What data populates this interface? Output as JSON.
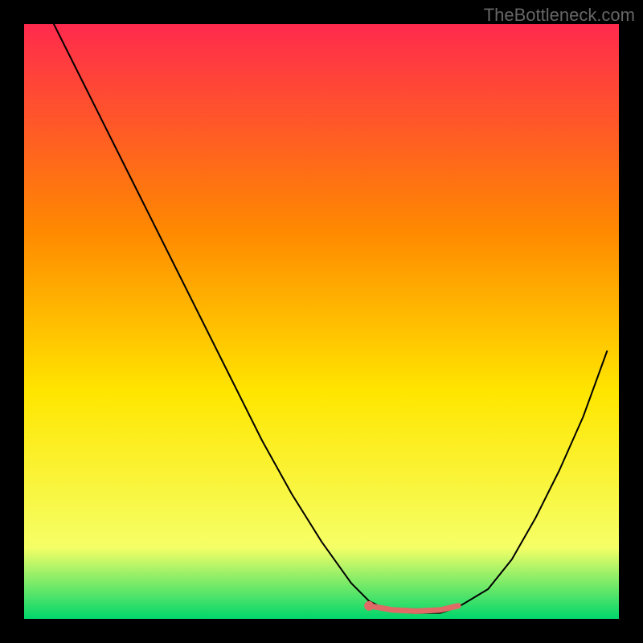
{
  "watermark": "TheBottleneck.com",
  "chart_data": {
    "type": "line",
    "title": "",
    "xlabel": "",
    "ylabel": "",
    "xlim": [
      0,
      100
    ],
    "ylim": [
      0,
      100
    ],
    "background_gradient": {
      "top": "#ff2a4d",
      "mid1": "#ff8a00",
      "mid2": "#ffe600",
      "mid3": "#f5ff66",
      "bottom": "#00d66b"
    },
    "series": [
      {
        "name": "curve",
        "color": "#000000",
        "stroke_width": 2,
        "x": [
          5,
          10,
          15,
          20,
          25,
          30,
          35,
          40,
          45,
          50,
          55,
          58,
          60,
          65,
          70,
          73,
          78,
          82,
          86,
          90,
          94,
          98
        ],
        "values": [
          100,
          90,
          80,
          70,
          60,
          50,
          40,
          30,
          21,
          13,
          6,
          3,
          2,
          1,
          1,
          2,
          5,
          10,
          17,
          25,
          34,
          45
        ]
      },
      {
        "name": "highlight-segment",
        "color": "#e06a66",
        "stroke_width": 7,
        "x": [
          58,
          62,
          66,
          70,
          73
        ],
        "values": [
          2.2,
          1.5,
          1.3,
          1.5,
          2.2
        ]
      }
    ],
    "markers": [
      {
        "name": "highlight-dot",
        "x": 58,
        "y": 2.2,
        "color": "#e06a66",
        "radius": 6
      }
    ]
  }
}
